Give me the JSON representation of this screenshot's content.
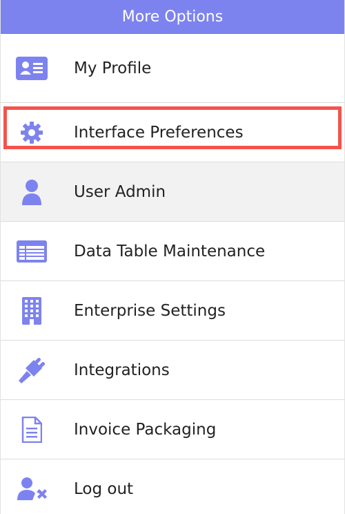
{
  "header": {
    "title": "More Options"
  },
  "colors": {
    "accent": "#7d83ee",
    "highlight": "#f2544d",
    "hover_bg": "#f2f2f2"
  },
  "menu": {
    "items": [
      {
        "label": "My Profile",
        "icon": "id-card-icon"
      },
      {
        "label": "Interface Preferences",
        "icon": "gear-icon"
      },
      {
        "label": "User Admin",
        "icon": "user-icon"
      },
      {
        "label": "Data Table Maintenance",
        "icon": "table-icon"
      },
      {
        "label": "Enterprise Settings",
        "icon": "building-icon"
      },
      {
        "label": "Integrations",
        "icon": "plug-icon"
      },
      {
        "label": "Invoice Packaging",
        "icon": "document-icon"
      },
      {
        "label": "Log out",
        "icon": "user-remove-icon"
      }
    ]
  }
}
